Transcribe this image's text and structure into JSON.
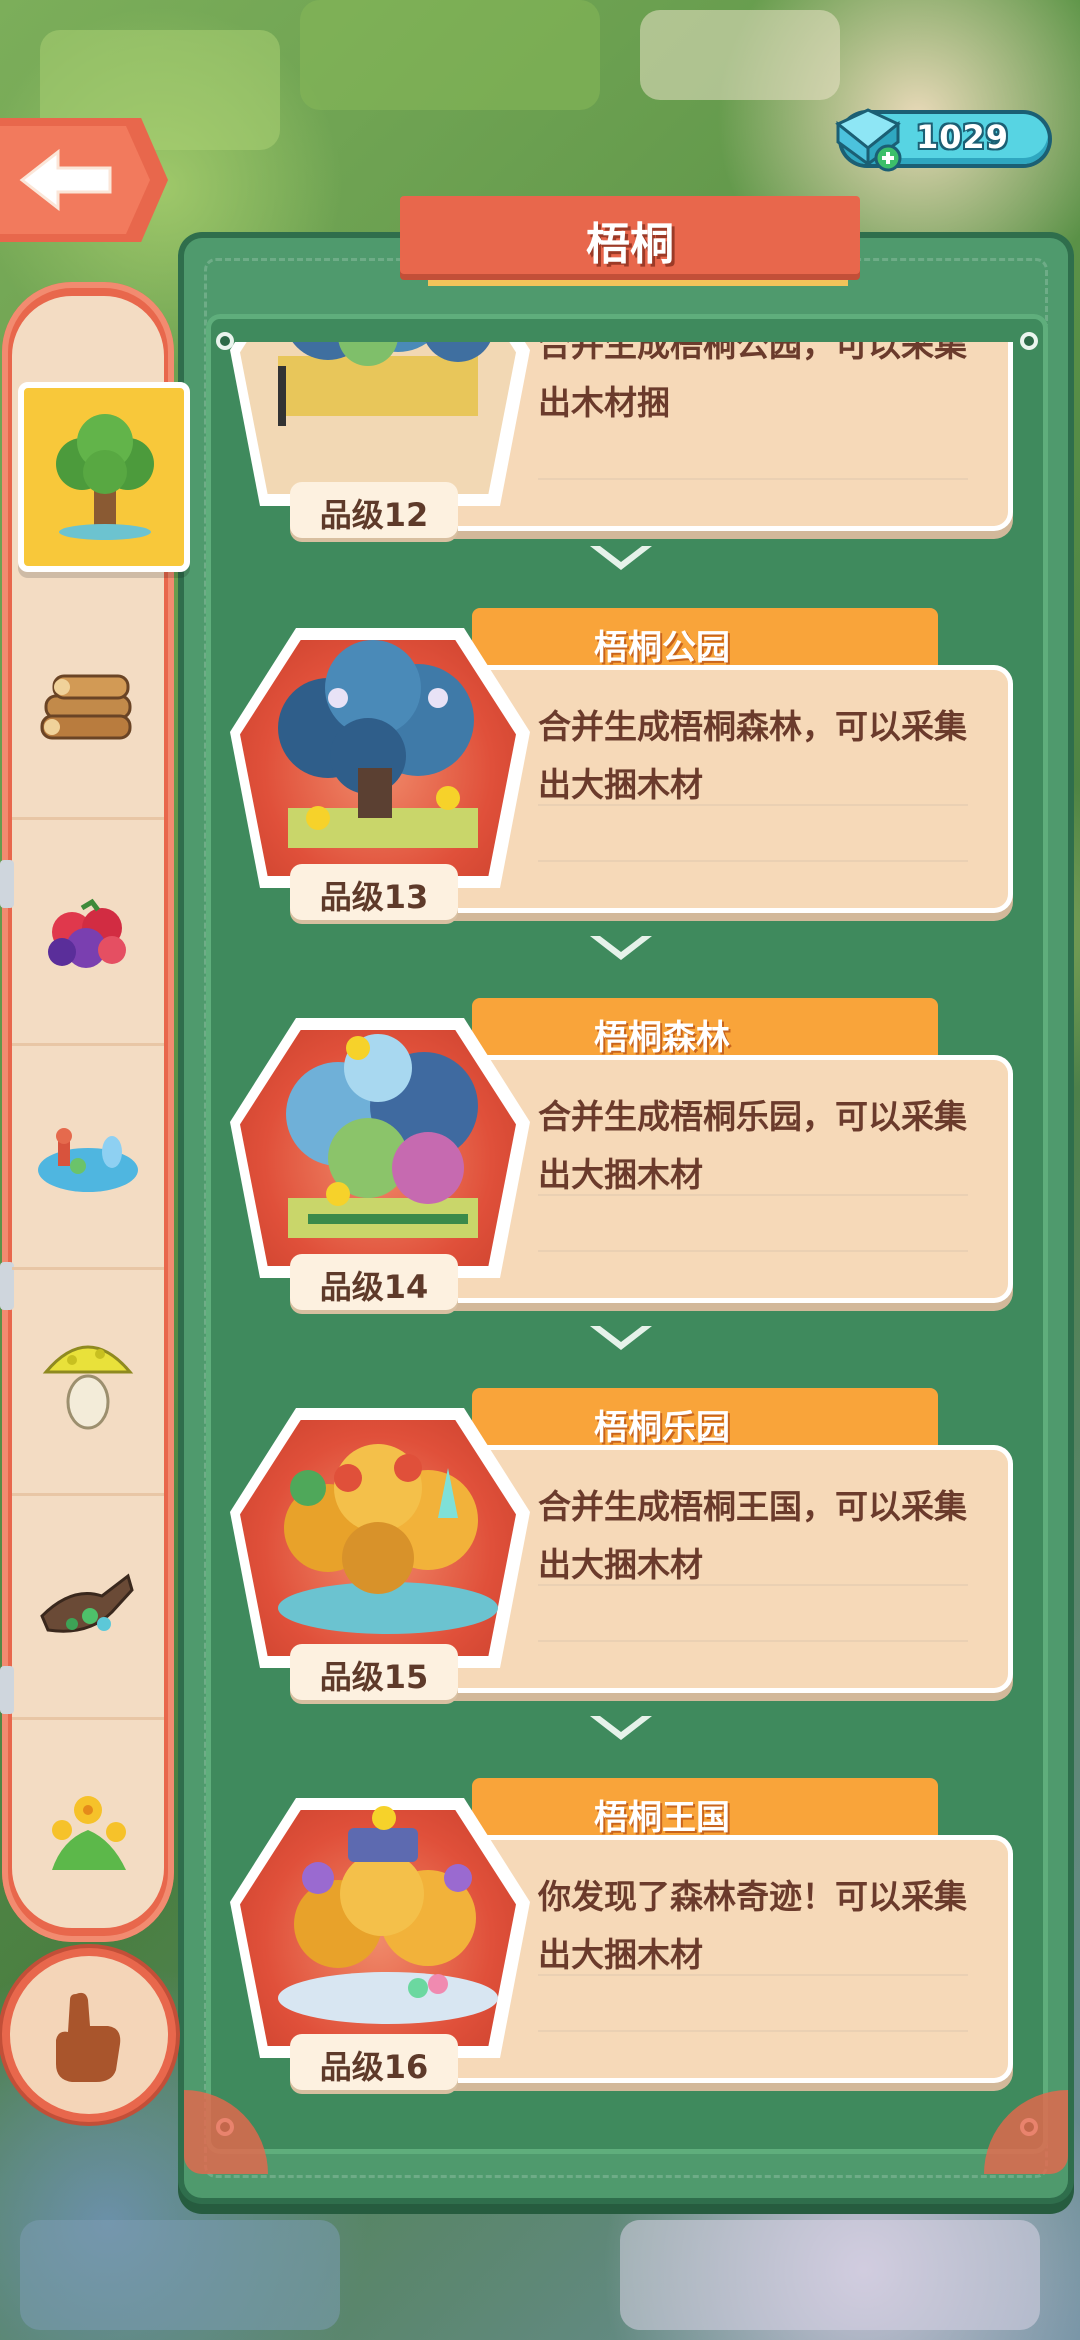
{
  "header": {
    "title": "梧桐",
    "gems": "1029"
  },
  "sidebar": {
    "items": [
      {
        "name": "tree",
        "selected": true
      },
      {
        "name": "logs"
      },
      {
        "name": "berries"
      },
      {
        "name": "pond"
      },
      {
        "name": "mushroom"
      },
      {
        "name": "stump"
      },
      {
        "name": "flowers"
      }
    ]
  },
  "entries": [
    {
      "name": "",
      "desc": "合并生成梧桐公园，可以采集出木材捆",
      "grade": "品级12"
    },
    {
      "name": "梧桐公园",
      "desc": "合并生成梧桐森林，可以采集出大捆木材",
      "grade": "品级13"
    },
    {
      "name": "梧桐森林",
      "desc": "合并生成梧桐乐园，可以采集出大捆木材",
      "grade": "品级14"
    },
    {
      "name": "梧桐乐园",
      "desc": "合并生成梧桐王国，可以采集出大捆木材",
      "grade": "品级15"
    },
    {
      "name": "梧桐王国",
      "desc": "你发现了森林奇迹！可以采集出大捆木材",
      "grade": "品级16"
    }
  ]
}
